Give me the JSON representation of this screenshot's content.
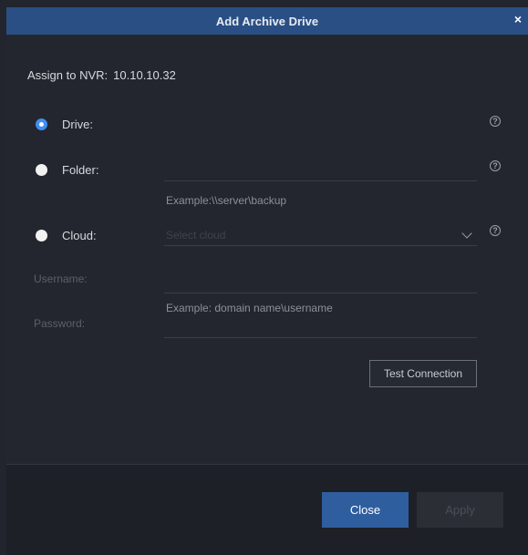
{
  "dialog": {
    "title": "Add Archive Drive",
    "close_glyph": "×"
  },
  "nvr": {
    "label": "Assign to NVR:",
    "value": "10.10.10.32"
  },
  "options": {
    "drive": {
      "label": "Drive:",
      "checked": true
    },
    "folder": {
      "label": "Folder:",
      "checked": false,
      "example": "Example:\\\\server\\backup"
    },
    "cloud": {
      "label": "Cloud:",
      "checked": false,
      "placeholder": "Select cloud"
    }
  },
  "credentials": {
    "username_label": "Username:",
    "password_label": "Password:",
    "username_example": "Example: domain name\\username"
  },
  "buttons": {
    "test_connection": "Test Connection",
    "close": "Close",
    "apply": "Apply"
  },
  "icons": {
    "help": "help-circle-icon",
    "chevron": "chevron-down-icon",
    "close": "close-icon"
  },
  "colors": {
    "title_bar": "#2a4f84",
    "accent": "#3f8ef4",
    "primary_button": "#2f5e9e"
  }
}
